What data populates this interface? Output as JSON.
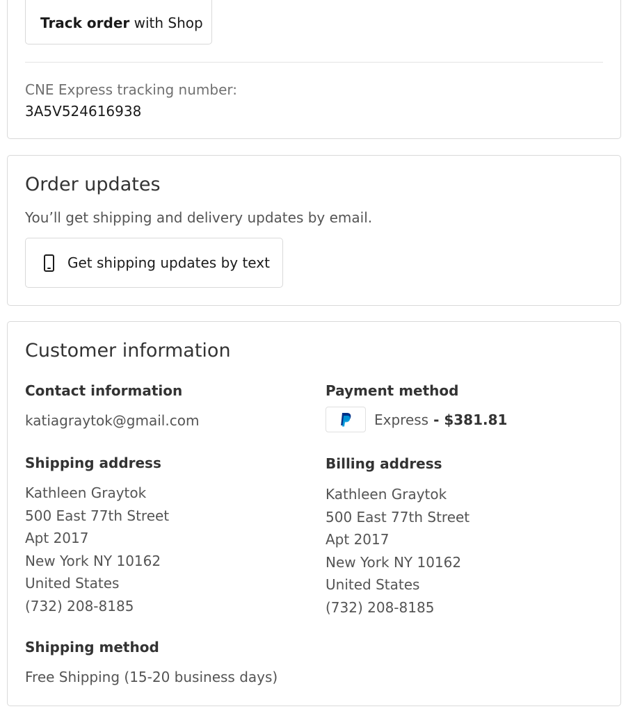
{
  "tracking": {
    "button_bold": "Track order",
    "button_rest": " with Shop",
    "label": "CNE Express tracking number:",
    "number": "3A5V524616938"
  },
  "order_updates": {
    "title": "Order updates",
    "description": "You’ll get shipping and delivery updates by email.",
    "sms_button_label": "Get shipping updates by text",
    "sms_icon": "phone-icon"
  },
  "customer": {
    "title": "Customer information",
    "contact": {
      "label": "Contact information",
      "email": "katiagraytok@gmail.com"
    },
    "payment": {
      "label": "Payment method",
      "icon": "paypal-icon",
      "method": "Express",
      "amount": " - $381.81"
    },
    "shipping_address": {
      "label": "Shipping address",
      "lines": [
        "Kathleen Graytok",
        "500 East 77th Street",
        "Apt 2017",
        "New York NY 10162",
        "United States",
        "(732) 208-8185"
      ]
    },
    "billing_address": {
      "label": "Billing address",
      "lines": [
        "Kathleen Graytok",
        "500 East 77th Street",
        "Apt 2017",
        "New York NY 10162",
        "United States",
        "(732) 208-8185"
      ]
    },
    "shipping_method": {
      "label": "Shipping method",
      "value": "Free Shipping (15-20 business days)"
    }
  },
  "colors": {
    "border": "#d9d9d9",
    "paypal_dark": "#003087",
    "paypal_light": "#009cde"
  }
}
